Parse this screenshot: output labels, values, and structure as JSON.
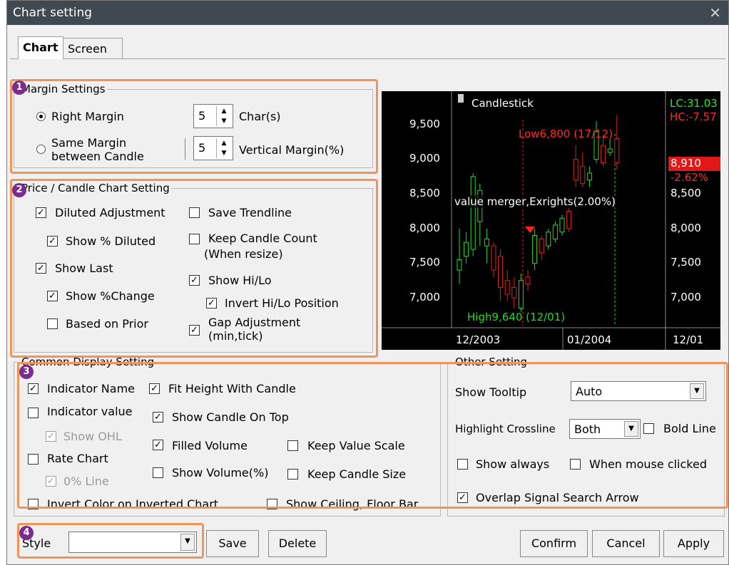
{
  "window": {
    "title": "Chart setting",
    "close_glyph": "✕"
  },
  "tabs": [
    {
      "label": "Chart"
    },
    {
      "label": "Screen"
    }
  ],
  "margin": {
    "legend": "Margin Settings",
    "right_margin_label": "Right Margin",
    "right_margin_value": "5",
    "chars_label": "Char(s)",
    "same_margin_label_1": "Same Margin",
    "same_margin_label_2": "between Candle",
    "vertical_value": "5",
    "vertical_label": "Vertical Margin(%)"
  },
  "price": {
    "legend": "Price / Candle Chart Setting",
    "diluted_adjustment": "Diluted Adjustment",
    "show_pct_diluted": "Show % Diluted",
    "show_last": "Show Last",
    "show_pct_change": "Show %Change",
    "based_on_prior": "Based on Prior",
    "save_trendline": "Save Trendline",
    "keep_candle_count_1": "Keep Candle Count",
    "keep_candle_count_2": "(When resize)",
    "show_hilo": "Show Hi/Lo",
    "invert_hilo": "Invert Hi/Lo Position",
    "gap_adjustment_1": "Gap Adjustment",
    "gap_adjustment_2": "(min,tick)"
  },
  "common": {
    "legend": "Common Display Setting",
    "indicator_name": "Indicator Name",
    "indicator_value": "Indicator value",
    "show_ohl": "Show OHL",
    "rate_chart": "Rate Chart",
    "zero_line": "0% Line",
    "invert_color": "Invert Color on Inverted Chart",
    "fit_height": "Fit Height With Candle",
    "show_candle_on_top": "Show Candle On Top",
    "filled_volume": "Filled Volume",
    "show_volume_pct": "Show Volume(%)",
    "keep_value_scale": "Keep Value Scale",
    "keep_candle_size": "Keep Candle Size",
    "show_ceiling": "Show Ceiling, Floor Bar"
  },
  "other": {
    "legend": "Other Setting",
    "tooltip_label": "Show Tooltip",
    "tooltip_value": "Auto",
    "crossline_label": "Highlight Crossline",
    "crossline_value": "Both",
    "bold_line": "Bold Line",
    "show_always": "Show always",
    "when_mouse_clicked": "When mouse clicked",
    "overlap_signal": "Overlap Signal Search Arrow"
  },
  "footer": {
    "style_label": "Style",
    "style_value": "",
    "save": "Save",
    "delete": "Delete",
    "confirm": "Confirm",
    "cancel": "Cancel",
    "apply": "Apply"
  },
  "badges": [
    "1",
    "2",
    "3",
    "4"
  ],
  "preview": {
    "legend": "Candlestick",
    "y_ticks": [
      "9,500",
      "9,000",
      "8,500",
      "8,000",
      "7,500",
      "7,000"
    ],
    "right_ticks": [
      "9,500",
      "9,000",
      "8,500",
      "8,000",
      "7,500",
      "7,000"
    ],
    "x_ticks": [
      "12/2003",
      "01/2004",
      "12/01"
    ],
    "lc": "LC:31.03",
    "hc": "HC:-7.57",
    "last_price": "8,910",
    "last_change": "-2.62%",
    "low_label": "Low6,800 (17/12)",
    "high_label": "High9,640 (12/01)",
    "event_label": "value merger,Exrights(2.00%)"
  },
  "chart_data": {
    "type": "candlestick",
    "title": "Candlestick",
    "x_ticks": [
      "12/2003",
      "01/2004"
    ],
    "ylim": [
      6700,
      9900
    ],
    "y_ticks": [
      7000,
      7500,
      8000,
      8500,
      9000,
      9500
    ],
    "candles": [
      {
        "o": 7400,
        "c": 7550,
        "h": 8000,
        "l": 7200,
        "up": true
      },
      {
        "o": 7600,
        "c": 7800,
        "h": 7950,
        "l": 7500,
        "up": true
      },
      {
        "o": 7700,
        "c": 8750,
        "h": 8800,
        "l": 7600,
        "up": true
      },
      {
        "o": 8100,
        "c": 8550,
        "h": 8650,
        "l": 7750,
        "up": true
      },
      {
        "o": 7750,
        "c": 7850,
        "h": 8000,
        "l": 7500,
        "up": true
      },
      {
        "o": 7750,
        "c": 7400,
        "h": 7800,
        "l": 7300,
        "up": false
      },
      {
        "o": 7600,
        "c": 7150,
        "h": 7700,
        "l": 6950,
        "up": false
      },
      {
        "o": 7250,
        "c": 7050,
        "h": 7400,
        "l": 6950,
        "up": false
      },
      {
        "o": 7150,
        "c": 7000,
        "h": 7300,
        "l": 6850,
        "up": false
      },
      {
        "o": 6850,
        "c": 7250,
        "h": 7350,
        "l": 6800,
        "up": true
      },
      {
        "o": 7300,
        "c": 7200,
        "h": 7400,
        "l": 7100,
        "up": false
      },
      {
        "o": 7500,
        "c": 7900,
        "h": 8000,
        "l": 7400,
        "up": true
      },
      {
        "o": 7850,
        "c": 7650,
        "h": 7900,
        "l": 7550,
        "up": false
      },
      {
        "o": 7750,
        "c": 7950,
        "h": 8000,
        "l": 7700,
        "up": true
      },
      {
        "o": 7850,
        "c": 8050,
        "h": 8100,
        "l": 7800,
        "up": true
      },
      {
        "o": 7950,
        "c": 8150,
        "h": 8200,
        "l": 7900,
        "up": true
      },
      {
        "o": 8000,
        "c": 8250,
        "h": 8300,
        "l": 7950,
        "up": false
      },
      {
        "o": 8700,
        "c": 9000,
        "h": 9200,
        "l": 8600,
        "up": false
      },
      {
        "o": 8650,
        "c": 8900,
        "h": 9100,
        "l": 8600,
        "up": false
      },
      {
        "o": 8700,
        "c": 8800,
        "h": 8900,
        "l": 8600,
        "up": true
      },
      {
        "o": 9000,
        "c": 9400,
        "h": 9550,
        "l": 8950,
        "up": true
      },
      {
        "o": 8950,
        "c": 9200,
        "h": 9350,
        "l": 8900,
        "up": false
      },
      {
        "o": 9100,
        "c": 9150,
        "h": 9300,
        "l": 9050,
        "up": true
      },
      {
        "o": 9300,
        "c": 8950,
        "h": 9640,
        "l": 8850,
        "up": false
      }
    ]
  }
}
